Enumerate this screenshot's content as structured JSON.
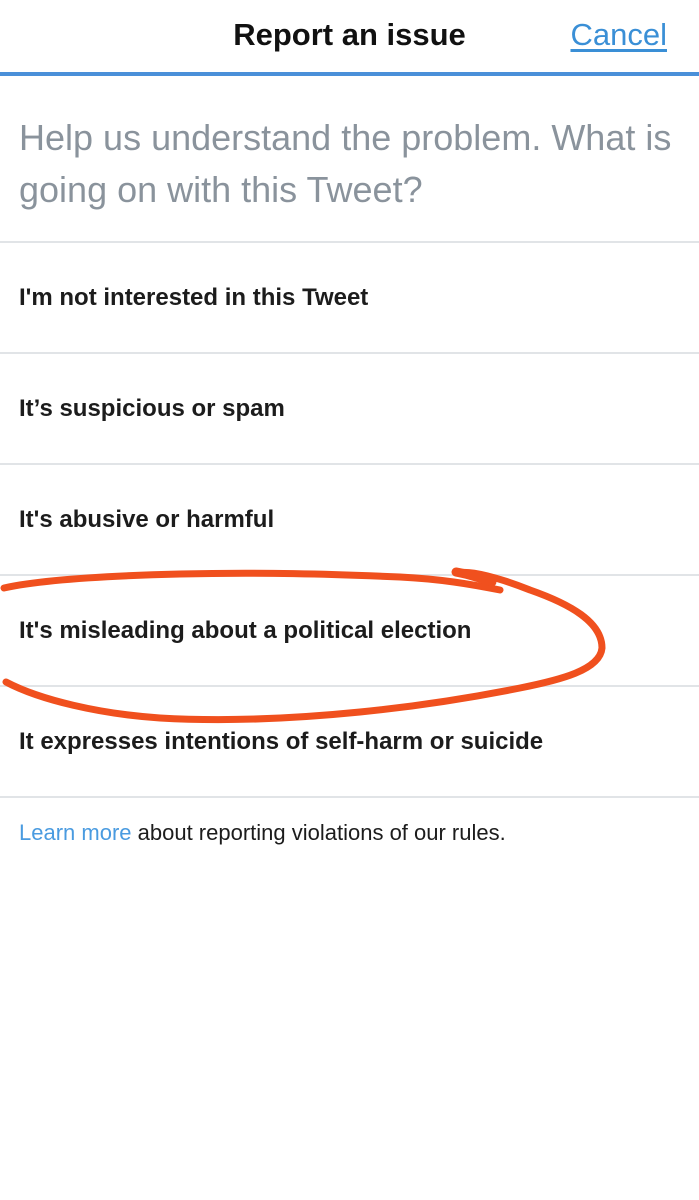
{
  "header": {
    "title": "Report an issue",
    "cancel_label": "Cancel"
  },
  "prompt": "Help us understand the problem. What is going on with this Tweet?",
  "options": [
    {
      "label": "I'm not interested in this Tweet"
    },
    {
      "label": "It’s suspicious or spam"
    },
    {
      "label": "It's abusive or harmful"
    },
    {
      "label": "It's misleading about a political election"
    },
    {
      "label": "It expresses intentions of self-harm or suicide"
    }
  ],
  "footer": {
    "link_text": "Learn more",
    "rest_text": " about reporting violations of our rules."
  },
  "colors": {
    "accent": "#4a90d9",
    "link": "#3a8fd6",
    "annotation": "#f0501e"
  }
}
